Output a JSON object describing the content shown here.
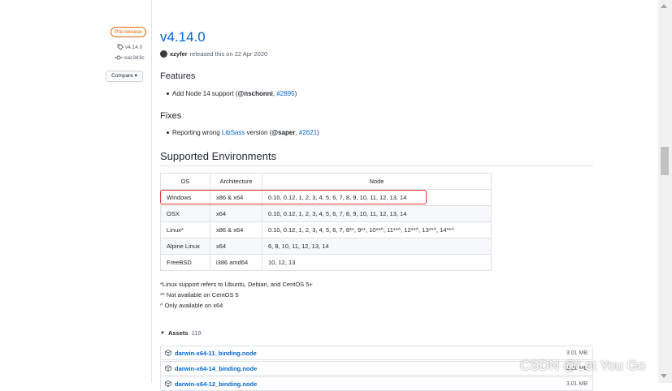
{
  "sidebar": {
    "badge": "Pre-release",
    "tag": "v4.14.0",
    "commit": "eac343c",
    "compare_label": "Compare"
  },
  "release": {
    "title": "v4.14.0",
    "author": "xzyfer",
    "released_text": "released this on 22 Apr 2020"
  },
  "features": {
    "heading": "Features",
    "items": [
      {
        "text": "Add Node 14 support (",
        "handle": "@nschonni",
        "sep": ", ",
        "ref": "#2895",
        "end": ")"
      }
    ]
  },
  "fixes": {
    "heading": "Fixes",
    "items": [
      {
        "text": "Reporting wrong ",
        "link": "LibSass",
        "text2": " version (",
        "handle": "@saper",
        "sep": ", ",
        "ref": "#2621",
        "end": ")"
      }
    ]
  },
  "environments": {
    "heading": "Supported Environments",
    "columns": [
      "OS",
      "Architecture",
      "Node"
    ],
    "rows": [
      {
        "os": "Windows",
        "arch": "x86 & x64",
        "node": "0.10, 0.12, 1, 2, 3, 4, 5, 6, 7, 8, 9, 10, 11, 12, 13, 14"
      },
      {
        "os": "OSX",
        "arch": "x64",
        "node": "0.10, 0.12, 1, 2, 3, 4, 5, 6, 7, 8, 9, 10, 11, 12, 13, 14"
      },
      {
        "os": "Linux*",
        "arch": "x86 & x64",
        "node": "0.10, 0.12, 1, 2, 3, 4, 5, 6, 7, 8**, 9**, 10**^, 11**^, 12**^, 13**^, 14**^"
      },
      {
        "os": "Alpine Linux",
        "arch": "x64",
        "node": "6, 8, 10, 11, 12, 13, 14"
      },
      {
        "os": "FreeBSD",
        "arch": "i386 amd64",
        "node": "10, 12, 13"
      }
    ],
    "notes": [
      "*Linux support refers to Ubuntu, Debian, and CentOS 5+",
      "** Not available on CentOS 5",
      "^ Only available on x64"
    ]
  },
  "assets": {
    "label": "Assets",
    "count": "119",
    "items": [
      {
        "name": "darwin-x64-11_binding.node",
        "size": "3.01 MB"
      },
      {
        "name": "darwin-x64-14_binding.node",
        "size": "3.01 MB"
      },
      {
        "name": "darwin-x64-12_binding.node",
        "size": "3.01 MB"
      }
    ]
  },
  "watermark": "CSDN @Let You Go",
  "colors": {
    "link": "#0366d6",
    "badge": "#e36209",
    "highlight": "#e53935"
  }
}
